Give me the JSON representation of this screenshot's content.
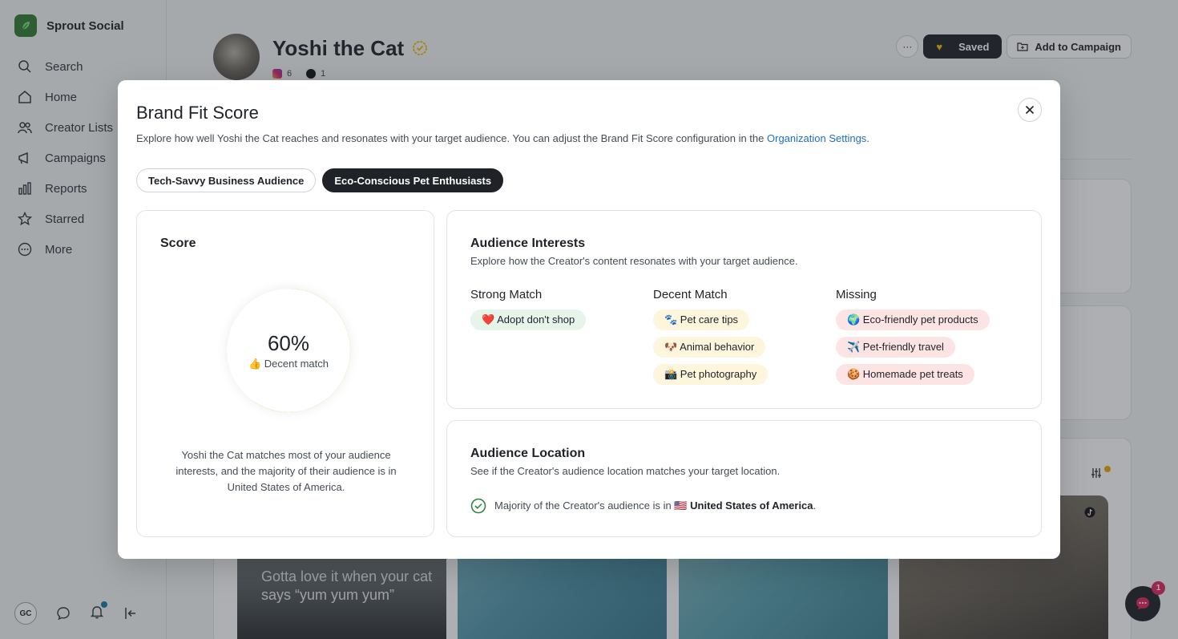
{
  "app": {
    "brand": "Sprout Social",
    "nav": [
      {
        "label": "Search",
        "icon": "search-icon"
      },
      {
        "label": "Home",
        "icon": "home-icon"
      },
      {
        "label": "Creator Lists",
        "icon": "users-icon"
      },
      {
        "label": "Campaigns",
        "icon": "megaphone-icon"
      },
      {
        "label": "Reports",
        "icon": "bar-chart-icon"
      },
      {
        "label": "Starred",
        "icon": "star-icon"
      },
      {
        "label": "More",
        "icon": "more-icon"
      }
    ],
    "user_initials": "GC"
  },
  "profile": {
    "name": "Yoshi the Cat",
    "instagram_count": "6",
    "tiktok_count": "1",
    "more_label": "···",
    "saved_label": "Saved",
    "campaign_label": "Add to Campaign"
  },
  "media": {
    "caption_1": "Gotta love it when your cat says “yum yum yum”"
  },
  "chat": {
    "badge": "1"
  },
  "modal": {
    "title": "Brand Fit Score",
    "description": "Explore how well Yoshi the Cat reaches and resonates with your target audience. You can adjust the Brand Fit Score configuration in the ",
    "link_text": "Organization Settings",
    "description_end": ".",
    "tabs": [
      {
        "label": "Tech-Savvy Business Audience",
        "active": false
      },
      {
        "label": "Eco-Conscious Pet Enthusiasts",
        "active": true
      }
    ],
    "score": {
      "heading": "Score",
      "value": "60%",
      "percent": 60,
      "label": "👍 Decent match",
      "summary": "Yoshi the Cat matches most of your audience interests, and the majority of their audience is in United States of America."
    },
    "interests": {
      "heading": "Audience Interests",
      "subtitle": "Explore how the Creator's content resonates with your target audience.",
      "strong_title": "Strong Match",
      "strong": [
        "❤️ Adopt don't shop"
      ],
      "decent_title": "Decent Match",
      "decent": [
        "🐾 Pet care tips",
        "🐶 Animal behavior",
        "📸 Pet photography"
      ],
      "missing_title": "Missing",
      "missing": [
        "🌍 Eco-friendly pet products",
        "✈️ Pet-friendly travel",
        "🍪 Homemade pet treats"
      ]
    },
    "location": {
      "heading": "Audience Location",
      "subtitle": "See if the Creator's audience location matches your target location.",
      "text": "Majority of the Creator's audience is in ",
      "flag": "🇺🇸",
      "country": "United States of America",
      "end": "."
    }
  },
  "colors": {
    "accent": "#f5b800",
    "dark": "#1f2328",
    "link": "#1f6fbf",
    "success": "#2e8540",
    "brand_green": "#2f7d32"
  }
}
